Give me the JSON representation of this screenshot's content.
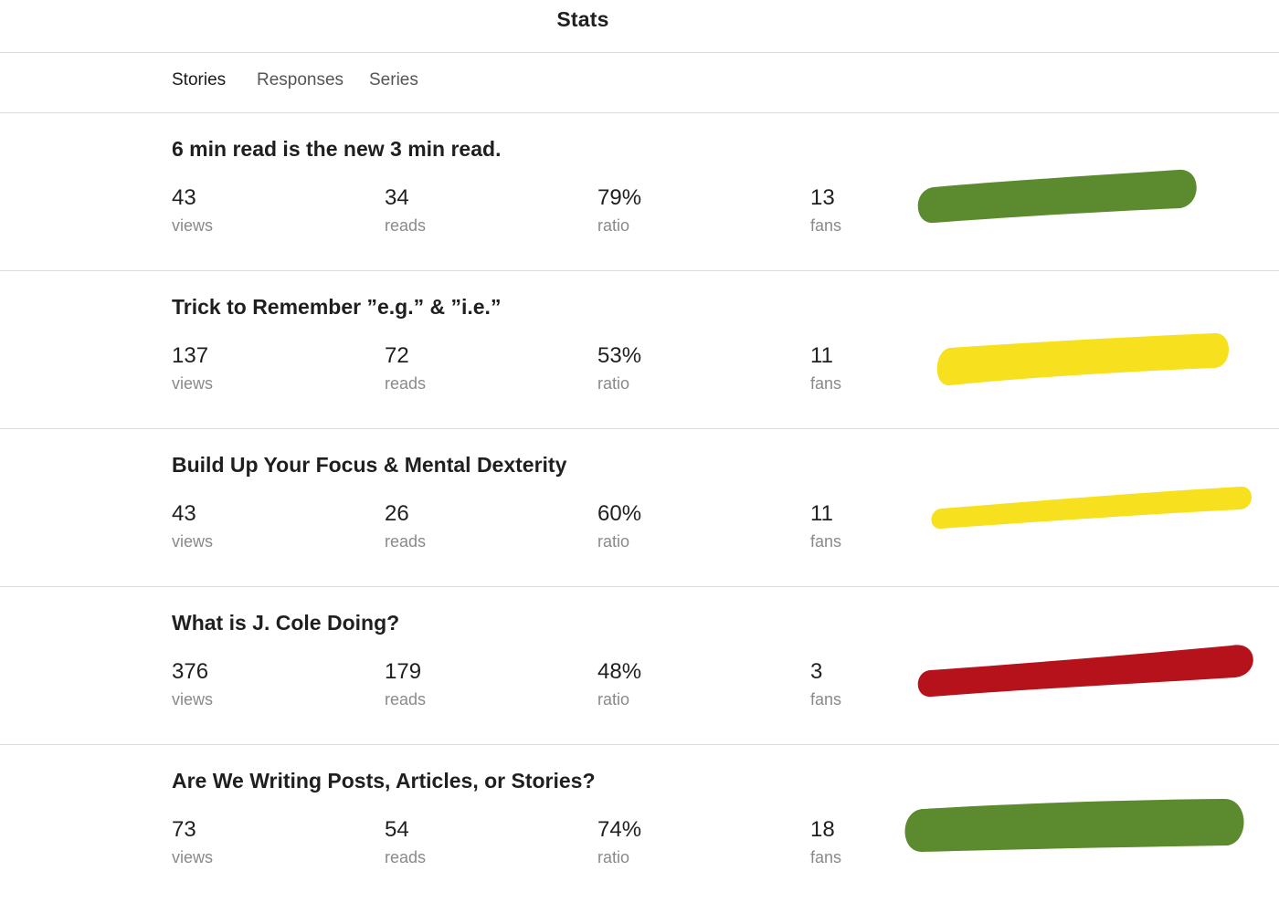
{
  "header": {
    "title": "Stats"
  },
  "tabs": [
    {
      "label": "Stories",
      "active": true
    },
    {
      "label": "Responses",
      "active": false
    },
    {
      "label": "Series",
      "active": false
    }
  ],
  "stories": [
    {
      "title": "6 min read is the new 3 min read.",
      "views": "43",
      "views_label": "views",
      "reads": "34",
      "reads_label": "reads",
      "ratio": "79%",
      "ratio_label": "ratio",
      "fans": "13",
      "fans_label": "fans",
      "marker_color": "#5c8a2e"
    },
    {
      "title": "Trick to Remember ”e.g.” & ”i.e.”",
      "views": "137",
      "views_label": "views",
      "reads": "72",
      "reads_label": "reads",
      "ratio": "53%",
      "ratio_label": "ratio",
      "fans": "11",
      "fans_label": "fans",
      "marker_color": "#f7e01d"
    },
    {
      "title": "Build Up Your Focus & Mental Dexterity",
      "views": "43",
      "views_label": "views",
      "reads": "26",
      "reads_label": "reads",
      "ratio": "60%",
      "ratio_label": "ratio",
      "fans": "11",
      "fans_label": "fans",
      "marker_color": "#f7e01d"
    },
    {
      "title": "What is J. Cole Doing?",
      "views": "376",
      "views_label": "views",
      "reads": "179",
      "reads_label": "reads",
      "ratio": "48%",
      "ratio_label": "ratio",
      "fans": "3",
      "fans_label": "fans",
      "marker_color": "#b5121b"
    },
    {
      "title": "Are We Writing Posts, Articles, or Stories?",
      "views": "73",
      "views_label": "views",
      "reads": "54",
      "reads_label": "reads",
      "ratio": "74%",
      "ratio_label": "ratio",
      "fans": "18",
      "fans_label": "fans",
      "marker_color": "#5c8a2e"
    }
  ]
}
